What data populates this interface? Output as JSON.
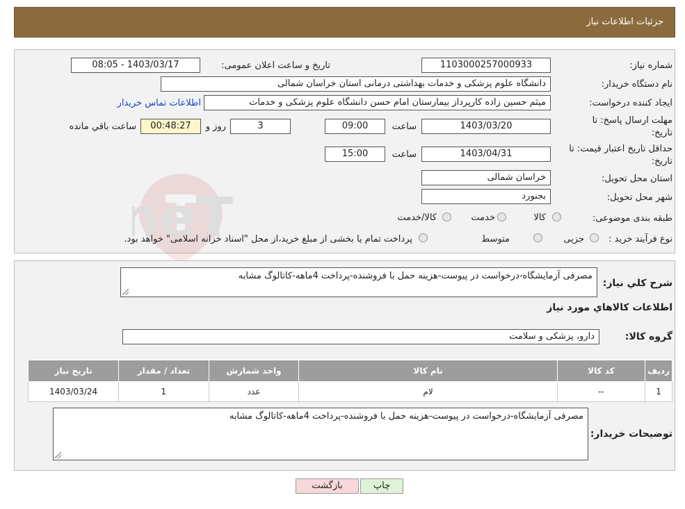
{
  "header": {
    "title": "جزئیات اطلاعات نیاز"
  },
  "form": {
    "need_number_label": "شماره نیاز:",
    "need_number": "1103000257000933",
    "announce_label": "تاریخ و ساعت اعلان عمومی:",
    "announce_value": "1403/03/17 - 08:05",
    "buyer_org_label": "نام دستگاه خریدار:",
    "buyer_org": "دانشگاه علوم پزشکی و خدمات بهداشتی درمانی استان خراسان شمالی",
    "requester_label": "ایجاد کننده درخواست:",
    "requester": "میثم  حسین زاده  کارپرداز بیمارستان امام حسن دانشگاه علوم پزشکی و خدمات",
    "contact_link": "اطلاعات تماس خریدار",
    "deadline_label_1": "مهلت ارسال پاسخ: تا",
    "deadline_label_2": "تاریخ:",
    "deadline_date": "1403/03/20",
    "time_label": "ساعت",
    "deadline_time": "09:00",
    "days_value": "3",
    "days_label": "روز و",
    "remaining_time": "00:48:27",
    "remaining_label": "ساعت باقي مانده",
    "validity_label_1": "حداقل تاريخ اعتبار قيمت: تا",
    "validity_label_2": "تاريخ:",
    "validity_date": "1403/04/31",
    "validity_time": "15:00",
    "province_label": "استان محل تحویل:",
    "province": "خراسان شمالی",
    "city_label": "شهر محل تحویل:",
    "city": "بجنورد",
    "category_label": "طبقه بندی موضوعی:",
    "category_options": [
      "کالا",
      "خدمت",
      "کالا/خدمت"
    ],
    "process_label": "نوع فرآیند خرید :",
    "process_options": [
      "جزیی",
      "متوسط"
    ],
    "process_note": "پرداخت تمام یا بخشی از مبلغ خرید،از محل \"اسناد خزانه اسلامی\" خواهد بود."
  },
  "details": {
    "summary_label": "شرح کلي نياز:",
    "summary": "مصرفی آزمایشگاه-درخواست در پیوست-هزینه حمل با فروشنده-پرداخت 4ماهه-کاتالوگ مشابه",
    "goods_info_title": "اطلاعات کالاهاي مورد نياز",
    "goods_group_label": "گروه کالا:",
    "goods_group": "دارو، پزشکی و سلامت",
    "table": {
      "headers": [
        "رديف",
        "کد کالا",
        "نام کالا",
        "واحد شمارش",
        "تعداد / مقدار",
        "تاريخ نياز"
      ],
      "rows": [
        [
          "1",
          "--",
          "لام",
          "عدد",
          "1",
          "1403/03/24"
        ]
      ]
    },
    "buyer_notes_label": "توضیحات خریدار:",
    "buyer_notes": "مصرفی آزمایشگاه-درخواست در پیوست-هزینه حمل با فروشنده-پرداخت 4ماهه-کاتالوگ مشابه"
  },
  "buttons": {
    "print": "چاپ",
    "back": "بازگشت"
  },
  "watermark": {
    "text": "AriaTender.neT"
  },
  "colors": {
    "header": "#8b6b3d",
    "link": "#0d47c9",
    "table_header": "#9d9d9d",
    "back_button": "#f7d9d9",
    "print_button": "#dff3d8"
  }
}
